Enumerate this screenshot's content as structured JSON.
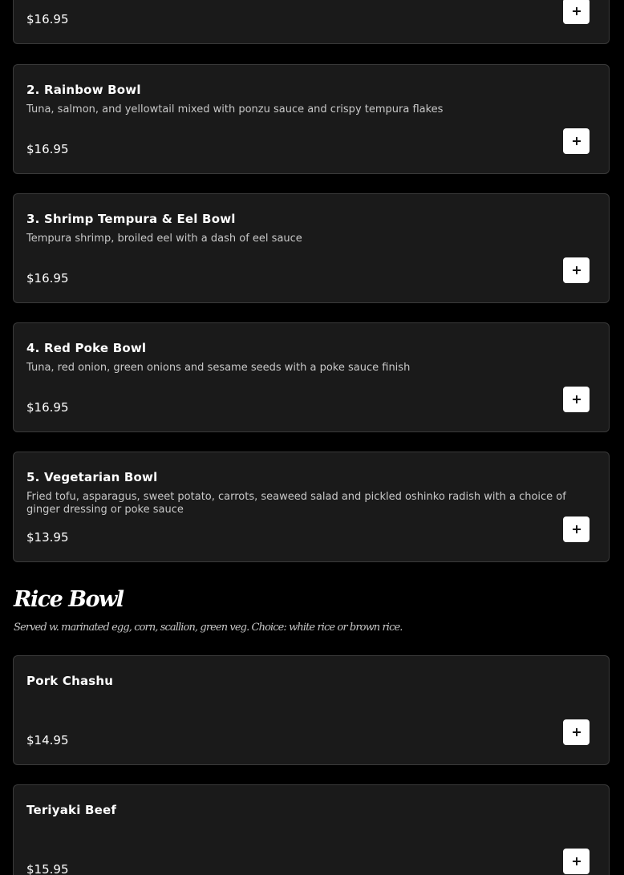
{
  "items_top": [
    {
      "name": "",
      "desc": "",
      "price": "$16.95"
    },
    {
      "name": "2. Rainbow Bowl",
      "desc": "Tuna, salmon, and yellowtail mixed with ponzu sauce and crispy tempura flakes",
      "price": "$16.95"
    },
    {
      "name": "3. Shrimp Tempura & Eel Bowl",
      "desc": "Tempura shrimp, broiled eel with a dash of eel sauce",
      "price": "$16.95"
    },
    {
      "name": "4. Red Poke Bowl",
      "desc": "Tuna, red onion, green onions and sesame seeds with a poke sauce finish",
      "price": "$16.95"
    },
    {
      "name": "5. Vegetarian Bowl",
      "desc": "Fried tofu, asparagus, sweet potato, carrots, seaweed salad and pickled oshinko radish with a choice of ginger dressing or poke sauce",
      "price": "$13.95"
    }
  ],
  "rice_section": {
    "title": "Rice Bowl",
    "subtitle": "Served w. marinated egg, corn, scallion, green veg. Choice: white rice or brown rice."
  },
  "items_rice": [
    {
      "name": "Pork Chashu",
      "desc": "",
      "price": "$14.95"
    },
    {
      "name": "Teriyaki Beef",
      "desc": "",
      "price": "$15.95"
    }
  ],
  "icons": {
    "add": "plus-icon"
  },
  "colors": {
    "background": "#000000",
    "card": "#1a1a1a",
    "card_border": "#3a3a3a",
    "button": "#ffffff",
    "text": "#ffffff",
    "muted_text": "#c8c8c8"
  }
}
